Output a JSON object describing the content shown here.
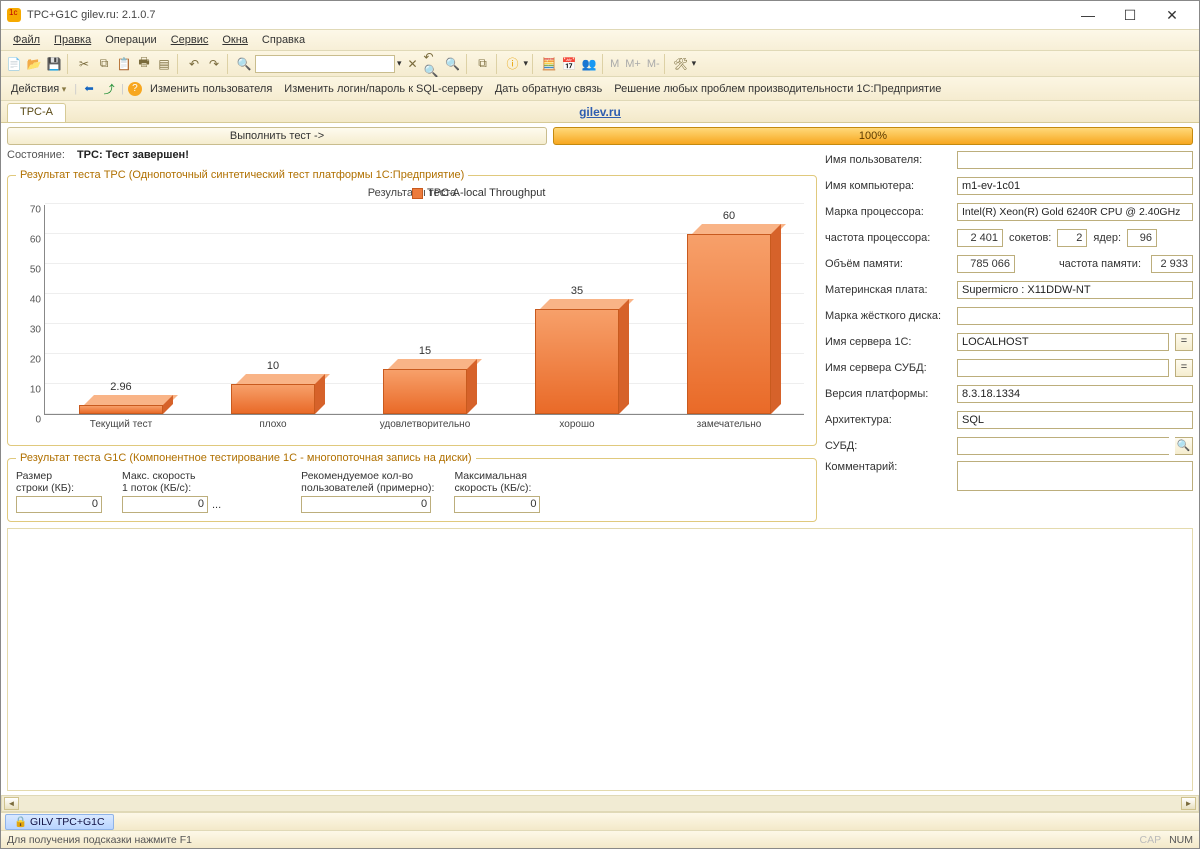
{
  "window": {
    "title": "TPC+G1C gilev.ru: 2.1.0.7",
    "minimize": "—",
    "maximize": "☐",
    "close": "✕"
  },
  "menu": {
    "file": "Файл",
    "edit": "Правка",
    "operations": "Операции",
    "service": "Сервис",
    "windows": "Окна",
    "help": "Справка"
  },
  "toolbar_m": {
    "m": "M",
    "mplus": "M+",
    "mminus": "M-"
  },
  "actions_bar": {
    "actions": "Действия",
    "change_user": "Изменить пользователя",
    "change_login": "Изменить логин/пароль к SQL-серверу",
    "feedback": "Дать обратную связь",
    "solve": "Решение любых проблем производительности 1С:Предприятие"
  },
  "tabs": {
    "tpca": "TPC-A",
    "brand": "gilev.ru"
  },
  "run_button": "Выполнить тест ->",
  "progress": "100%",
  "state_label": "Состояние:",
  "state_value": "TPC: Тест завершен!",
  "tpc_group": "Результат теста TPC (Однопоточный синтетический тест платформы 1С:Предприятие)",
  "chart_data": {
    "type": "bar",
    "title": "Результаты теста",
    "legend": "TPC-A-local Throughput",
    "categories": [
      "Текущий тест",
      "плохо",
      "удовлетворительно",
      "хорошо",
      "замечательно"
    ],
    "values": [
      2.96,
      10,
      15,
      35,
      60
    ],
    "ylim": [
      0,
      70
    ],
    "yticks": [
      0,
      10,
      20,
      30,
      40,
      50,
      60,
      70
    ]
  },
  "g1c_group": "Результат теста G1C (Компонентное тестирование 1C - многопоточная запись на диски)",
  "g1c": {
    "rowsize_label": "Размер\nстроки (КБ):",
    "maxspeed1_label": "Макс. скорость\n1 поток (КБ/c):",
    "recusers_label": "Рекомендуемое кол-во\nпользователей (примерно):",
    "maxspeed_label": "Максимальная\nскорость (КБ/c):",
    "rowsize": "0",
    "maxspeed1": "0",
    "ellipsis": "...",
    "recusers": "0",
    "maxspeed": "0"
  },
  "form": {
    "username_l": "Имя пользователя:",
    "username": "",
    "computer_l": "Имя компьютера:",
    "computer": "m1-ev-1c01",
    "cpu_brand_l": "Марка процессора:",
    "cpu_brand": "Intel(R) Xeon(R) Gold 6240R CPU @ 2.40GHz",
    "cpu_freq_l": "частота процессора:",
    "cpu_freq": "2 401",
    "sockets_l": "сокетов:",
    "sockets": "2",
    "cores_l": "ядер:",
    "cores": "96",
    "mem_l": "Объём памяти:",
    "mem": "785 066",
    "memfreq_l": "частота памяти:",
    "memfreq": "2 933",
    "mb_l": "Материнская плата:",
    "mb": "Supermicro : X11DDW-NT",
    "hdd_l": "Марка жёсткого диска:",
    "hdd": "",
    "srv1c_l": "Имя сервера 1С:",
    "srv1c": "LOCALHOST",
    "srvdb_l": "Имя сервера СУБД:",
    "srvdb": "",
    "platver_l": "Версия платформы:",
    "platver": "8.3.18.1334",
    "arch_l": "Архитектура:",
    "arch": "SQL",
    "dbms_l": "СУБД:",
    "dbms": "",
    "comment_l": "Комментарий:",
    "eq": "="
  },
  "window_tab": "GILV TPC+G1C",
  "status": {
    "hint": "Для получения подсказки нажмите F1",
    "cap": "CAP",
    "num": "NUM"
  }
}
